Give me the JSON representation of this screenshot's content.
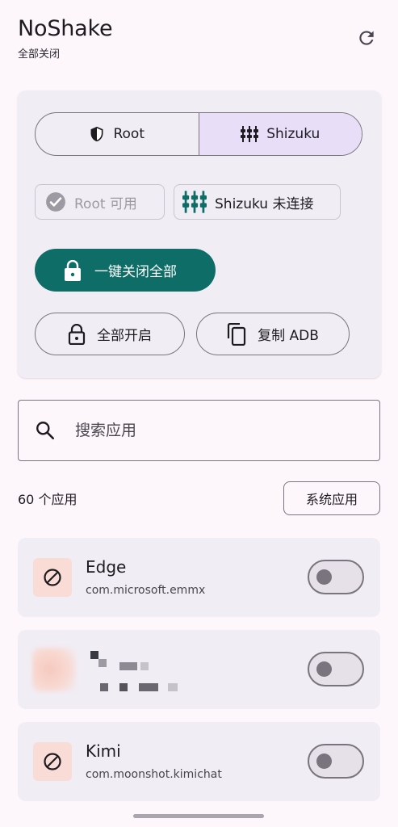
{
  "header": {
    "title": "NoShake",
    "subtitle": "全部关闭",
    "refresh_icon": "refresh-icon"
  },
  "mode": {
    "root_label": "Root",
    "shizuku_label": "Shizuku",
    "selected": "Shizuku"
  },
  "status": {
    "root_status": "Root 可用",
    "shizuku_status": "Shizuku 未连接"
  },
  "actions": {
    "lock_all": "一键关闭全部",
    "open_all": "全部开启",
    "copy_adb": "复制 ADB"
  },
  "search": {
    "placeholder": "搜索应用"
  },
  "list_header": {
    "count_label": "60 个应用",
    "system_apps_button": "系统应用"
  },
  "apps": [
    {
      "name": "Edge",
      "package": "com.microsoft.emmx",
      "enabled": false,
      "icon": "block-icon"
    },
    {
      "name": "",
      "package": "",
      "enabled": false,
      "icon": "blurred-avatar"
    },
    {
      "name": "Kimi",
      "package": "com.moonshot.kimichat",
      "enabled": false,
      "icon": "block-icon"
    }
  ],
  "colors": {
    "primary": "#0e6e67",
    "segment_selected": "#e8def8",
    "card_background": "#f1edf4",
    "app_icon_background": "#f9dcd6"
  }
}
